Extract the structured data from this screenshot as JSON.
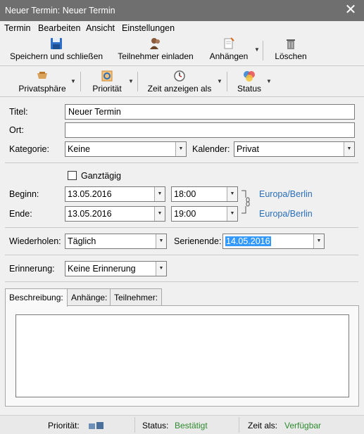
{
  "window": {
    "title": "Neuer Termin: Neuer Termin"
  },
  "menu": {
    "termin": "Termin",
    "bearbeiten": "Bearbeiten",
    "ansicht": "Ansicht",
    "einstellungen": "Einstellungen"
  },
  "toolbar1": {
    "save": "Speichern und schließen",
    "invite": "Teilnehmer einladen",
    "attach": "Anhängen",
    "delete": "Löschen"
  },
  "toolbar2": {
    "privacy": "Privatsphäre",
    "priority": "Priorität",
    "showtime": "Zeit anzeigen als",
    "status": "Status"
  },
  "form": {
    "title_label": "Titel:",
    "title_value": "Neuer Termin",
    "location_label": "Ort:",
    "location_value": "",
    "category_label": "Kategorie:",
    "category_value": "Keine",
    "calendar_label": "Kalender:",
    "calendar_value": "Privat",
    "allday_label": "Ganztägig",
    "start_label": "Beginn:",
    "start_date": "13.05.2016",
    "start_time": "18:00",
    "start_tz": "Europa/Berlin",
    "end_label": "Ende:",
    "end_date": "13.05.2016",
    "end_time": "19:00",
    "end_tz": "Europa/Berlin",
    "repeat_label": "Wiederholen:",
    "repeat_value": "Täglich",
    "series_end_label": "Serienende:",
    "series_end_value": "14.05.2016",
    "reminder_label": "Erinnerung:",
    "reminder_value": "Keine Erinnerung"
  },
  "tabs": [
    {
      "label": "Beschreibung:"
    },
    {
      "label": "Anhänge:"
    },
    {
      "label": "Teilnehmer:"
    }
  ],
  "statusbar": {
    "priority_label": "Priorität:",
    "status_label": "Status:",
    "status_value": "Bestätigt",
    "showas_label": "Zeit als:",
    "showas_value": "Verfügbar"
  },
  "colors": {
    "link": "#2a6ebb",
    "status_green": "#2e8b2e",
    "selection": "#3399ff",
    "titlebar": "#6f6f6f"
  }
}
